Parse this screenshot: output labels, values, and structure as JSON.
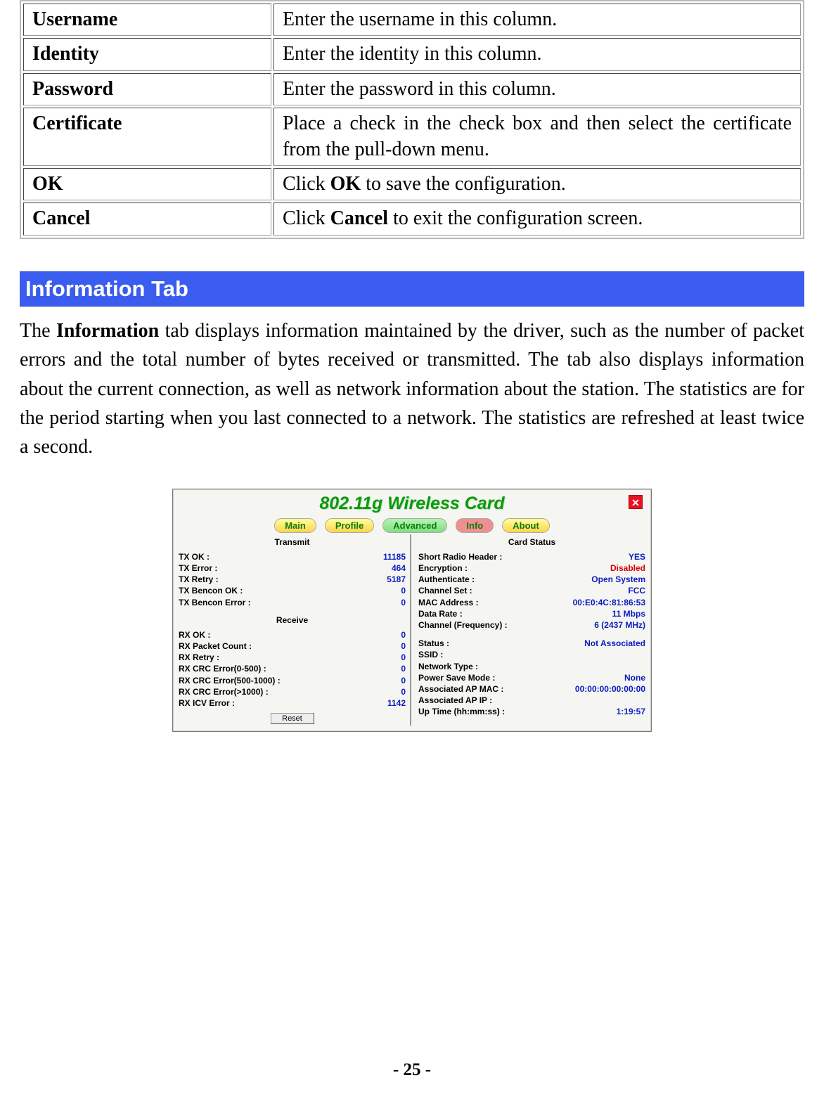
{
  "def_table": [
    {
      "key": "Username",
      "val_html": "Enter the username in this column."
    },
    {
      "key": "Identity",
      "val_html": "Enter the identity in this column."
    },
    {
      "key": "Password",
      "val_html": "Enter the password in this column."
    },
    {
      "key": "Certificate",
      "val_html": "Place a check in the check box and then select the certificate from the pull-down menu."
    },
    {
      "key": "OK",
      "val_html": "Click <b>OK</b> to save the configuration."
    },
    {
      "key": "Cancel",
      "val_html": "Click <b>Cancel</b> to exit the configuration screen."
    }
  ],
  "section_title": "Information Tab",
  "paragraph_html": "The <b>Information</b> tab displays information maintained by the driver, such as the number of packet errors and the total number of bytes received or transmitted. The tab also displays information about the current connection, as well as network information about the station. The statistics are for the period starting when you last connected to a network. The statistics are refreshed at least twice a second.",
  "screenshot": {
    "title": "802.11g Wireless Card",
    "close_icon": "✕",
    "tabs": {
      "main": "Main",
      "profile": "Profile",
      "advanced": "Advanced",
      "info": "Info",
      "about": "About"
    },
    "left": {
      "transmit_head": "Transmit",
      "transmit": [
        {
          "label": "TX OK :",
          "value": "11185"
        },
        {
          "label": "TX Error :",
          "value": "464"
        },
        {
          "label": "TX Retry :",
          "value": "5187"
        },
        {
          "label": "TX Bencon OK :",
          "value": "0"
        },
        {
          "label": "TX Bencon Error :",
          "value": "0"
        }
      ],
      "receive_head": "Receive",
      "receive": [
        {
          "label": "RX OK :",
          "value": "0"
        },
        {
          "label": "RX Packet Count :",
          "value": "0"
        },
        {
          "label": "RX Retry :",
          "value": "0"
        },
        {
          "label": "RX CRC Error(0-500) :",
          "value": "0"
        },
        {
          "label": "RX CRC Error(500-1000) :",
          "value": "0"
        },
        {
          "label": "RX CRC Error(>1000) :",
          "value": "0"
        },
        {
          "label": "RX ICV Error :",
          "value": "1142"
        }
      ],
      "reset": "Reset"
    },
    "right": {
      "head": "Card Status",
      "rows1": [
        {
          "label": "Short Radio Header :",
          "value": "YES"
        },
        {
          "label": "Encryption :",
          "value": "Disabled",
          "dis": true
        },
        {
          "label": "Authenticate :",
          "value": "Open System"
        },
        {
          "label": "Channel Set :",
          "value": "FCC"
        },
        {
          "label": "MAC Address :",
          "value": "00:E0:4C:81:86:53"
        },
        {
          "label": "Data Rate :",
          "value": "11 Mbps"
        },
        {
          "label": "Channel (Frequency) :",
          "value": "6 (2437 MHz)"
        }
      ],
      "rows2": [
        {
          "label": "Status :",
          "value": "Not Associated"
        },
        {
          "label": "SSID :",
          "value": ""
        },
        {
          "label": "Network Type :",
          "value": ""
        },
        {
          "label": "Power Save Mode :",
          "value": "None"
        },
        {
          "label": "Associated AP MAC :",
          "value": "00:00:00:00:00:00"
        },
        {
          "label": "Associated AP IP :",
          "value": ""
        },
        {
          "label": "Up Time (hh:mm:ss) :",
          "value": "1:19:57"
        }
      ]
    }
  },
  "page_number": "- 25 -"
}
